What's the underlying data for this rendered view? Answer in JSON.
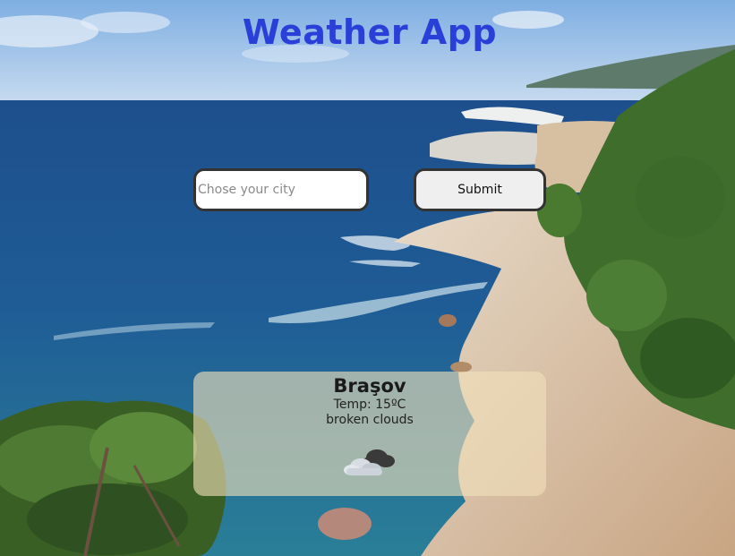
{
  "app": {
    "title": "Weather App"
  },
  "search": {
    "placeholder": "Chose your city",
    "value": "",
    "submit_label": "Submit"
  },
  "weather": {
    "city": "Braşov",
    "temp_line": "Temp: 15ºC",
    "description": "broken clouds",
    "icon": "broken-clouds-icon"
  },
  "colors": {
    "title": "#2a3fd8",
    "sky": "#8cb8e6",
    "sea": "#1e5a98",
    "rock": "#d9c3a4",
    "pine": "#3f6e2c",
    "card": "#f0e1b9"
  }
}
